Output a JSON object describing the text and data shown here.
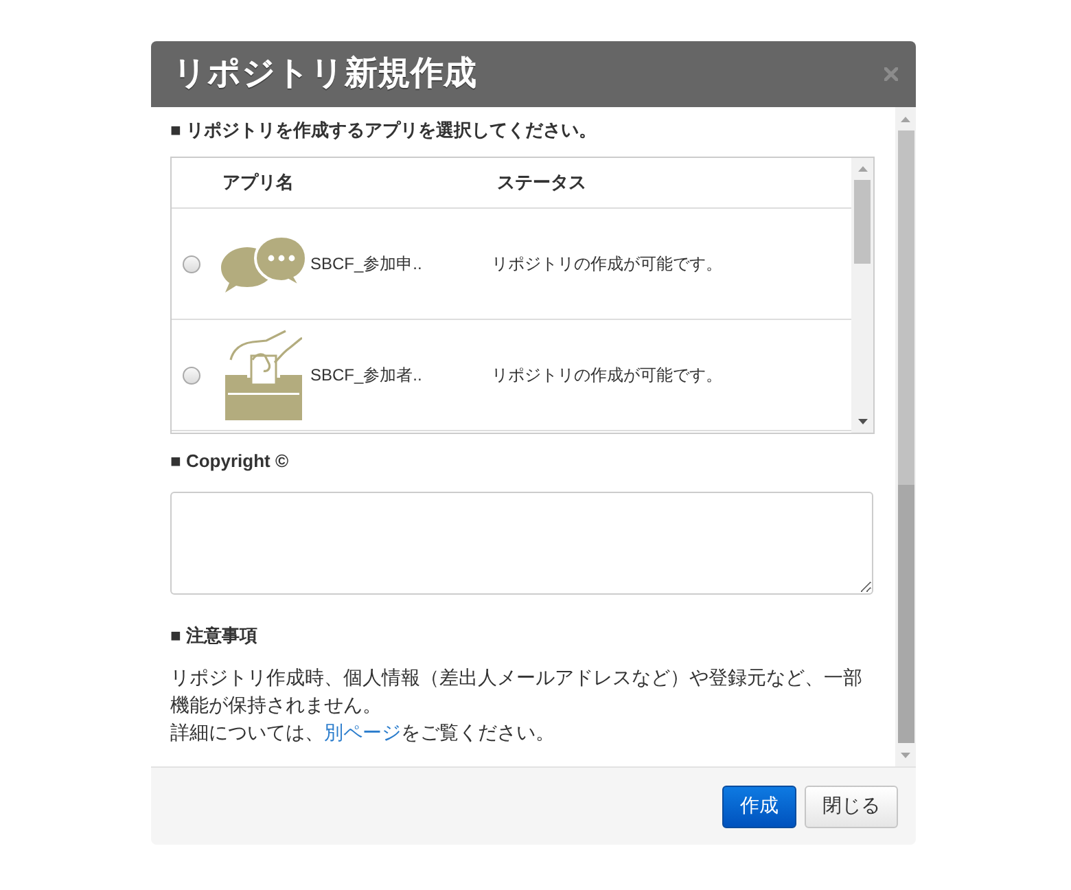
{
  "dialog": {
    "title": "リポジトリ新規作成"
  },
  "app_section": {
    "heading": "■ リポジトリを作成するアプリを選択してください。",
    "table": {
      "columns": [
        "アプリ名",
        "ステータス"
      ],
      "rows": [
        {
          "selected": false,
          "name": "SBCF_参加申..",
          "status": "リポジトリの作成が可能です。"
        },
        {
          "selected": false,
          "name": "SBCF_参加者..",
          "status": "リポジトリの作成が可能です。"
        }
      ]
    }
  },
  "copyright_section": {
    "heading": "■ Copyright ©"
  },
  "notes_section": {
    "heading": "■ 注意事項",
    "text": "リポジトリ作成時、個人情報（差出人メールアドレスなど）や登録元など、一部機能が保持されません。",
    "detail_before": "詳細については、",
    "link": "別ページ",
    "detail_after": "をご覧ください。"
  },
  "buttons": [
    {
      "label": "作成",
      "kind": "primary"
    },
    {
      "label": "閉じる",
      "kind": "default"
    }
  ]
}
